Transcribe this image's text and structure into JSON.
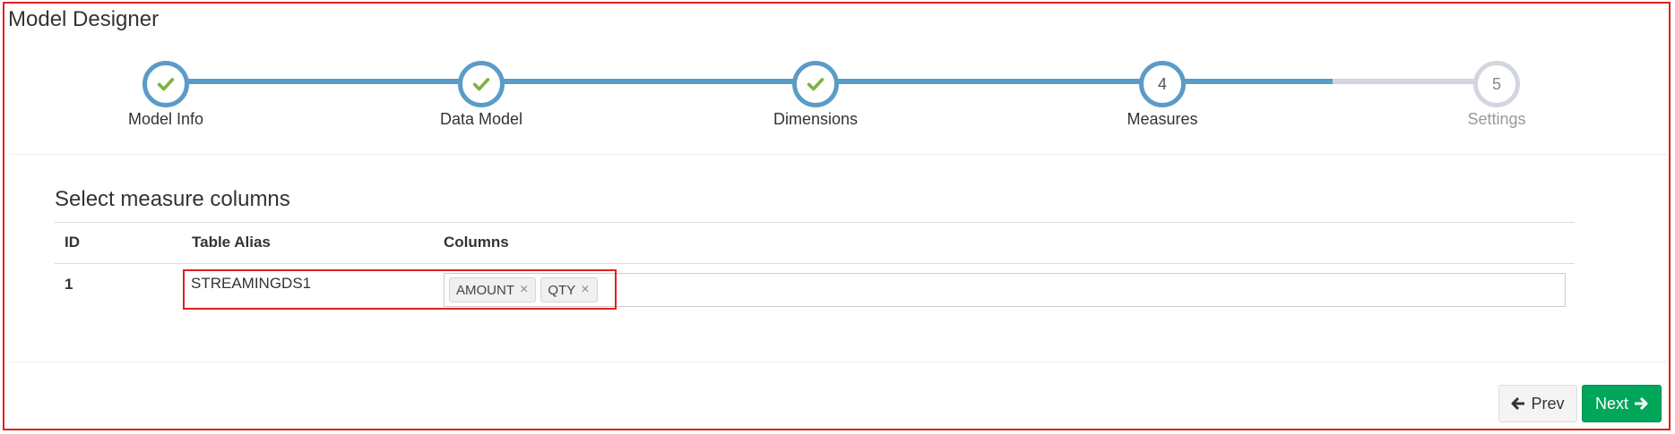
{
  "page": {
    "title": "Model Designer"
  },
  "wizard": {
    "steps": [
      {
        "label": "Model Info",
        "number": "1",
        "status": "complete"
      },
      {
        "label": "Data Model",
        "number": "2",
        "status": "complete"
      },
      {
        "label": "Dimensions",
        "number": "3",
        "status": "complete"
      },
      {
        "label": "Measures",
        "number": "4",
        "status": "active"
      },
      {
        "label": "Settings",
        "number": "5",
        "status": "todo"
      }
    ]
  },
  "section": {
    "title": "Select measure columns"
  },
  "table": {
    "headers": {
      "id": "ID",
      "alias": "Table Alias",
      "columns": "Columns"
    },
    "rows": [
      {
        "id": "1",
        "alias": "STREAMINGDS1",
        "tags": [
          "AMOUNT",
          "QTY"
        ]
      }
    ]
  },
  "tags": {
    "remove_glyph": "×"
  },
  "footer": {
    "prev_label": "Prev",
    "next_label": "Next"
  },
  "colors": {
    "accent": "#5b9bc8",
    "check": "#7cb342",
    "next": "#00a65a",
    "highlight": "#e02020"
  }
}
